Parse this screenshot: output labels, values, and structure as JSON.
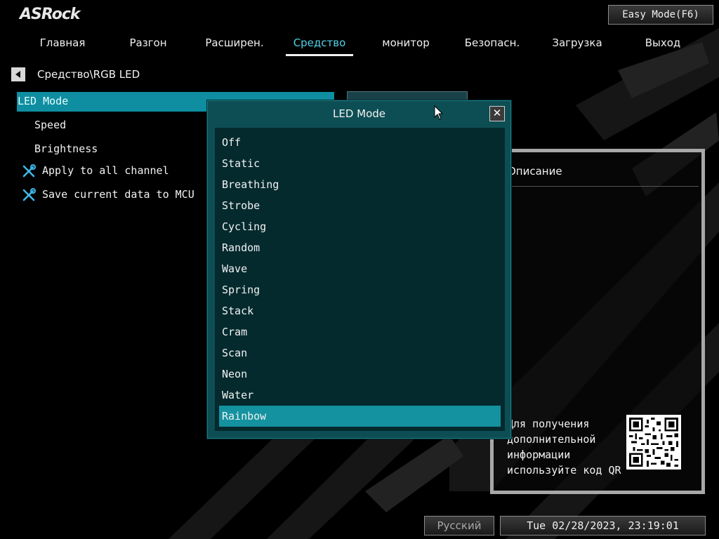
{
  "header": {
    "logo": "ASRock",
    "easy_mode_label": "Easy Mode(F6)"
  },
  "nav": {
    "tabs": [
      {
        "label": "Главная"
      },
      {
        "label": "Разгон"
      },
      {
        "label": "Расширен."
      },
      {
        "label": "Средство",
        "active": true
      },
      {
        "label": "монитор"
      },
      {
        "label": "Безопасн."
      },
      {
        "label": "Загрузка"
      },
      {
        "label": "Выход"
      }
    ]
  },
  "breadcrumb": "Средство\\RGB LED",
  "menu": {
    "items": [
      {
        "label": "LED Mode"
      },
      {
        "label": "Speed"
      },
      {
        "label": "Brightness"
      },
      {
        "label": "Apply to all channel",
        "icon": "wrench-screwdriver-icon"
      },
      {
        "label": "Save current data to MCU",
        "icon": "wrench-screwdriver-icon"
      }
    ]
  },
  "value_button": "Rainbow",
  "description": {
    "title": "Описание",
    "qr_text": "Для получения дополнительной информации используйте код QR"
  },
  "modal": {
    "title": "LED Mode",
    "options": [
      "Off",
      "Static",
      "Breathing",
      "Strobe",
      "Cycling",
      "Random",
      "Wave",
      "Spring",
      "Stack",
      "Cram",
      "Scan",
      "Neon",
      "Water",
      "Rainbow"
    ],
    "selected": "Rainbow"
  },
  "footer": {
    "language": "Русский",
    "datetime": "Tue 02/28/2023, 23:19:01"
  },
  "colors": {
    "accent": "#4ed4e6",
    "selection": "#14929f",
    "modal_bg": "#0d4e54",
    "list_bg": "#042a2e"
  }
}
